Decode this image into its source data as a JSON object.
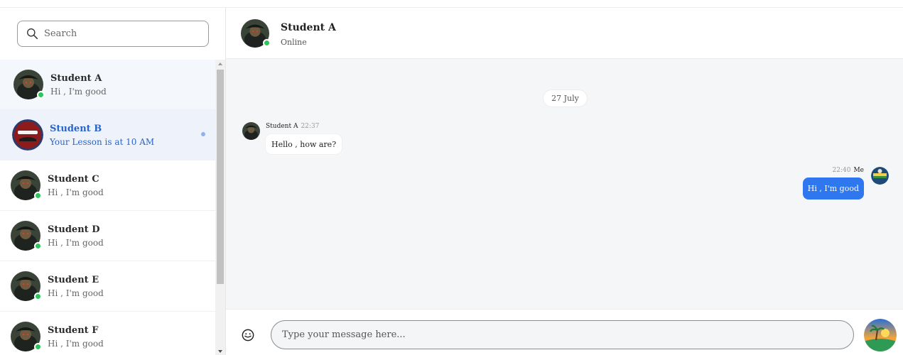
{
  "sidebar": {
    "search": {
      "placeholder": "Search",
      "icon": "search-icon"
    },
    "contacts": [
      {
        "name": "Student A",
        "preview": "Hi , I'm good",
        "online": true
      },
      {
        "name": "Student B",
        "preview": "Your Lesson is at 10 AM",
        "online": false,
        "active": true,
        "unread": true
      },
      {
        "name": "Student C",
        "preview": "Hi , I'm good",
        "online": true
      },
      {
        "name": "Student D",
        "preview": "Hi , I'm good",
        "online": true
      },
      {
        "name": "Student E",
        "preview": "Hi , I'm good",
        "online": true
      },
      {
        "name": "Student F",
        "preview": "Hi , I'm good",
        "online": true
      }
    ]
  },
  "chat": {
    "header": {
      "name": "Student A",
      "status": "Online"
    },
    "date_separator": "27 July",
    "messages": [
      {
        "direction": "incoming",
        "sender": "Student A",
        "time": "22:37",
        "text": "Hello , how are?"
      },
      {
        "direction": "outgoing",
        "sender": "Me",
        "time": "22:40",
        "text": "Hi , I'm good"
      }
    ],
    "composer": {
      "placeholder": "Type your message here...",
      "emoji_icon": "emoji-icon",
      "send_icon": "send-avatar-icon"
    }
  },
  "colors": {
    "accent": "#2f77ee",
    "active_text": "#2a63c9",
    "online": "#2ec55b",
    "chat_background": "#f5f6f8"
  }
}
